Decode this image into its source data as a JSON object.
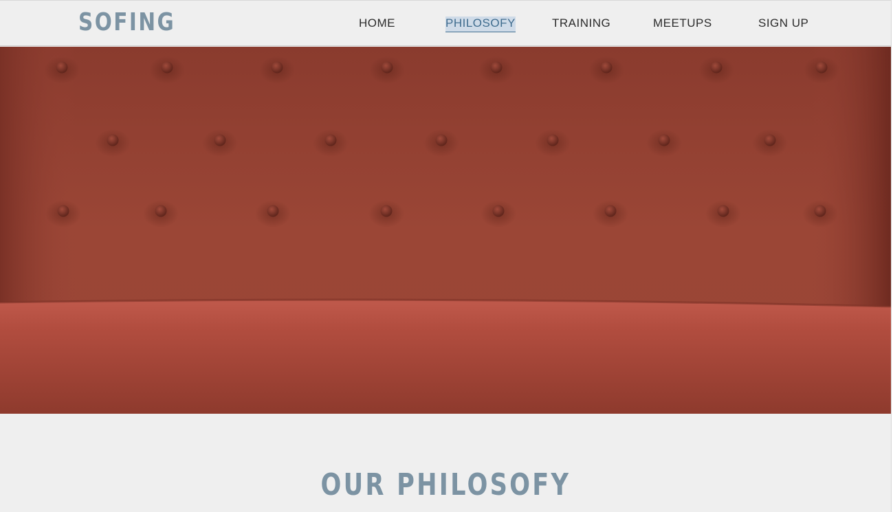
{
  "brand": {
    "logo_text": "SOFING",
    "accent_color": "#7c93a3"
  },
  "nav": {
    "items": [
      {
        "label": "HOME"
      },
      {
        "label": "PHILOSOFY",
        "active": true
      },
      {
        "label": "TRAINING"
      },
      {
        "label": "MEETUPS"
      },
      {
        "label": "SIGN UP"
      }
    ]
  },
  "hero": {
    "image": "red-tufted-velvet-sofa"
  },
  "philosophy": {
    "title": "OUR PHILOSOFY"
  }
}
